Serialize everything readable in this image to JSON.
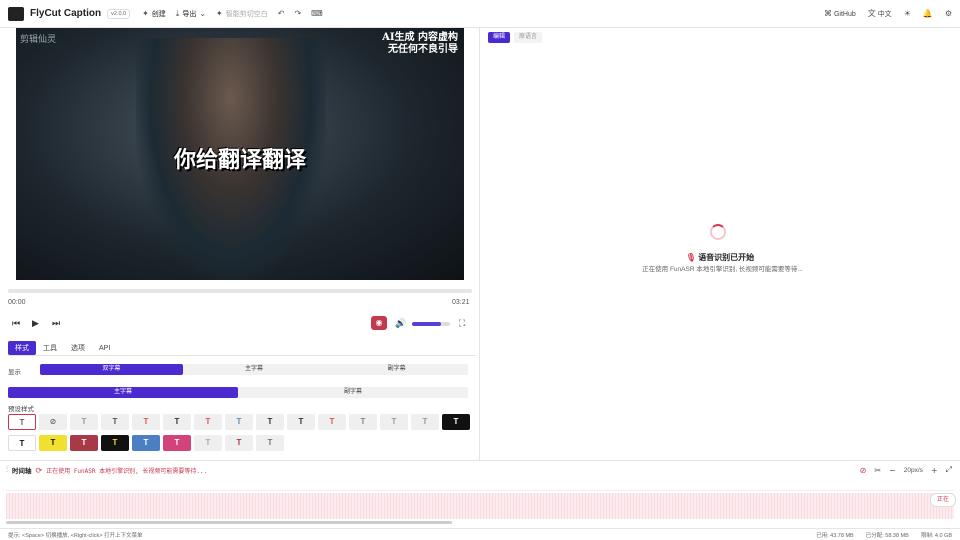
{
  "app": {
    "title": "FlyCut Caption",
    "version": "v2.0.0"
  },
  "toolbar": {
    "create": "创建",
    "export": "导出",
    "smart_cut": "智能剪切空白",
    "github": "GitHub",
    "language": "中文"
  },
  "video": {
    "watermark_left": "剪辑仙灵",
    "watermark_right_1": "AI生成 内容虚构",
    "watermark_right_2": "无任何不良引导",
    "subtitle": "你给翻译翻译"
  },
  "player": {
    "current_time": "00:00",
    "duration": "03:21",
    "volume_percent": 75
  },
  "tabs": [
    "样式",
    "工具",
    "选项",
    "API"
  ],
  "display": {
    "label": "显示",
    "options": [
      "双字幕",
      "主字幕",
      "副字幕"
    ]
  },
  "target": {
    "options": [
      "主字幕",
      "副字幕"
    ]
  },
  "presets": {
    "label": "预设样式"
  },
  "right_panel": {
    "tabs": [
      "编辑",
      "原语言"
    ],
    "asr_title": "语音识别已开始",
    "asr_sub": "正在使用 FunASR 本地引擎识别, 长视频可能需要等待..."
  },
  "timeline": {
    "title": "时间轴",
    "status": "正在使用 FunASR 本地引擎识别, 长视频可能需要等待...",
    "zoom": "20px/s",
    "float_btn": "正在"
  },
  "statusbar": {
    "hint": "提示: <Space> 切换播放, <Right-click> 打开上下文菜单",
    "used": "已用: 43.78 MB",
    "allocated": "已分配: 58.38 MB",
    "limit": "限制: 4.0 GB"
  },
  "colors": {
    "accent": "#4b2bd0",
    "danger": "#c5394f"
  }
}
